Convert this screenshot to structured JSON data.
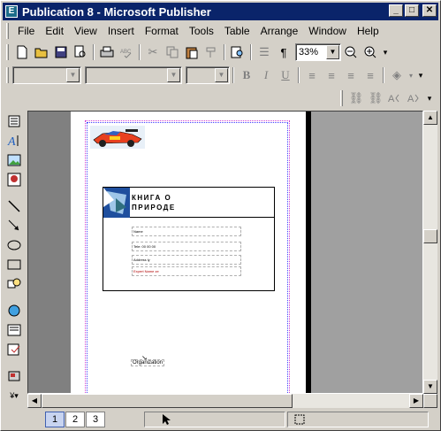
{
  "window": {
    "title": "Publication 8 - Microsoft Publisher",
    "app_icon_letter": "E"
  },
  "menu": {
    "items": [
      "File",
      "Edit",
      "View",
      "Insert",
      "Format",
      "Tools",
      "Table",
      "Arrange",
      "Window",
      "Help"
    ]
  },
  "standard_toolbar": {
    "zoom_value": "33%"
  },
  "document": {
    "book_title_line1": "КНИГА О",
    "book_title_line2": "ПРИРОДЕ",
    "field_1": "Name",
    "field_2": "Tele: 00 00 00",
    "field_3": "Address ly",
    "field_4": "Expert Name ze",
    "organization": "Organization"
  },
  "pages": {
    "tabs": [
      "1",
      "2",
      "3"
    ],
    "active": "1"
  },
  "colors": {
    "titlebar": "#0a246a",
    "face": "#d4d0c8",
    "workspace": "#808080"
  }
}
